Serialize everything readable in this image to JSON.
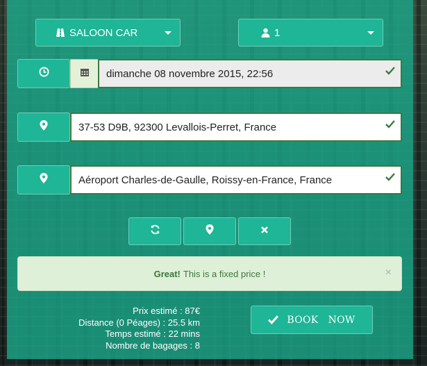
{
  "vehicle_select": {
    "value": "SALOON CAR",
    "icon": "road-icon"
  },
  "passengers_select": {
    "value": "1",
    "icon": "user-icon"
  },
  "datetime": {
    "value": "dimanche 08 novembre 2015, 22:56"
  },
  "pickup": {
    "value": "37-53 D9B, 92300 Levallois-Perret, France"
  },
  "dropoff": {
    "value": "Aéroport Charles-de-Gaulle, Roissy-en-France, France"
  },
  "alert": {
    "strong": "Great!",
    "text": "This is a fixed price !",
    "close": "×"
  },
  "summary": {
    "price": "Prix estimé : 87€",
    "distance": "Distance (0 Péages) : 25.5 km",
    "time": "Temps estimé : 22 mins",
    "luggage": "Nombre de bagages : 8"
  },
  "book_button": {
    "word1": "BOOK",
    "word2": "NOW"
  },
  "colors": {
    "accent": "#1fb597",
    "check": "#3b7a3b",
    "alert_bg": "#dff0d8"
  }
}
